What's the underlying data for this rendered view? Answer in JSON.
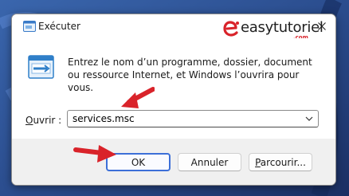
{
  "window": {
    "title": "Exécuter",
    "close_icon": "close-icon",
    "app_icon": "run-window-icon"
  },
  "watermark": {
    "text": "easytutoriel",
    "suffix": ".com",
    "logo_color": "#d9232a"
  },
  "content": {
    "description": "Entrez le nom d’un programme, dossier, document ou ressource Internet, et Windows l’ouvrira pour vous.",
    "open_label_underlined": "O",
    "open_label_rest": "uvrir :",
    "open_value": "services.msc"
  },
  "buttons": {
    "ok": "OK",
    "cancel": "Annuler",
    "browse_underlined": "P",
    "browse_rest": "arcourir..."
  },
  "colors": {
    "accent": "#3c6fd8",
    "annotation_arrow": "#d9232a"
  }
}
